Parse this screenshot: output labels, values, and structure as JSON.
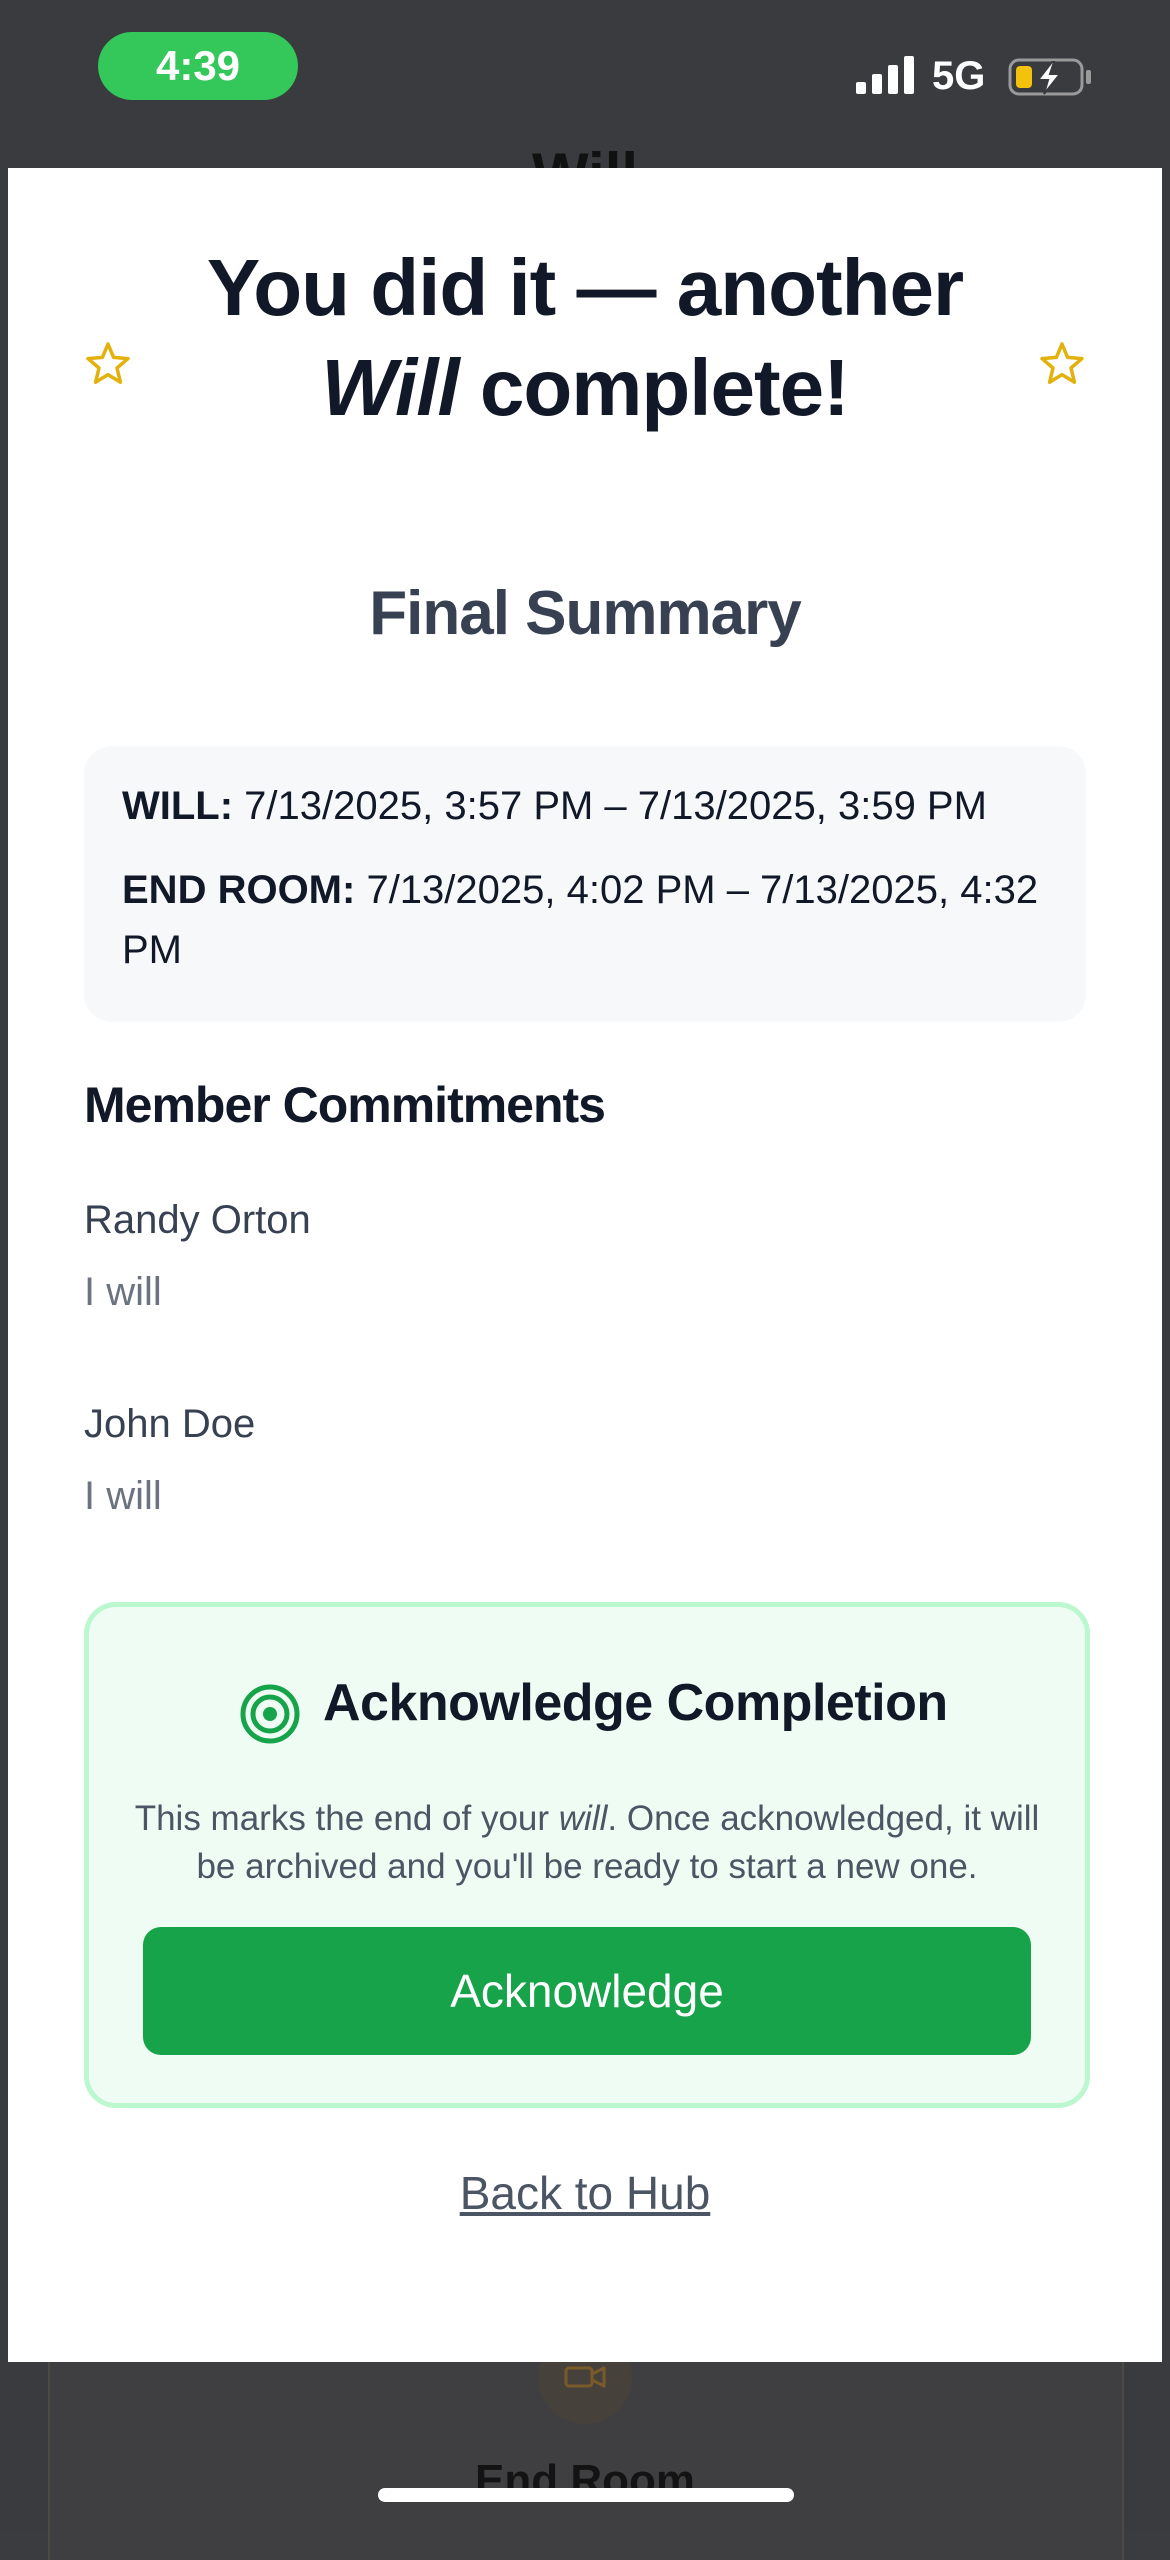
{
  "status_bar": {
    "time": "4:39",
    "network": "5G"
  },
  "background": {
    "title": "Will",
    "end_room_label": "End Room"
  },
  "modal": {
    "title_line1": "You did it — another",
    "title_will": "Will",
    "title_line2_rest": " complete!",
    "summary_heading": "Final Summary",
    "summary": {
      "will_label": "WILL:",
      "will_range": " 7/13/2025, 3:57 PM – 7/13/2025, 3:59 PM",
      "end_room_label": "END ROOM:",
      "end_room_range": " 7/13/2025, 4:02 PM – 7/13/2025, 4:32 PM"
    },
    "members_heading": "Member Commitments",
    "members": [
      {
        "name": "Randy Orton",
        "commitment": "I will"
      },
      {
        "name": "John Doe",
        "commitment": "I will"
      }
    ],
    "acknowledge": {
      "title": "Acknowledge Completion",
      "desc_part1": "This marks the end of your ",
      "desc_will": "will",
      "desc_part2": ". Once acknowledged, it will be archived and you'll be ready to start a new one.",
      "button_label": "Acknowledge"
    },
    "back_link": "Back to Hub"
  },
  "icons": {
    "stars": "star-outline-icon",
    "target": "target-icon",
    "video": "video-camera-icon"
  },
  "colors": {
    "accent_green": "#16a34a",
    "card_green_bg": "#effcf3",
    "star_gold": "#e3b10c",
    "status_green": "#34c759"
  }
}
